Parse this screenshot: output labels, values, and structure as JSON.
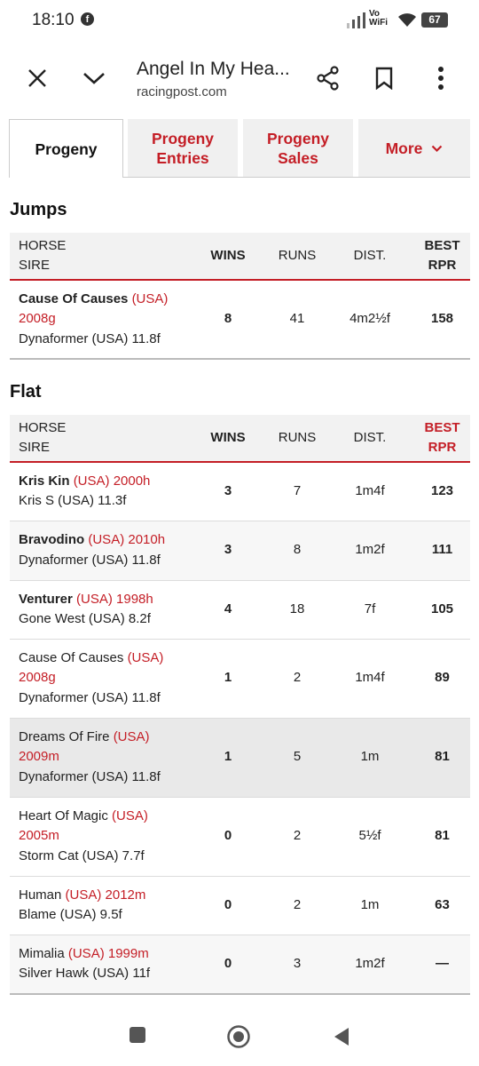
{
  "status": {
    "time": "18:10",
    "vowifi_top": "Vo",
    "vowifi_bottom": "WiFi",
    "battery": "67"
  },
  "appbar": {
    "title": "Angel In My Hea...",
    "url": "racingpost.com"
  },
  "tabs": [
    {
      "label_1": "Progeny",
      "label_2": ""
    },
    {
      "label_1": "Progeny",
      "label_2": "Entries"
    },
    {
      "label_1": "Progeny",
      "label_2": "Sales"
    },
    {
      "label_1": "More",
      "label_2": ""
    }
  ],
  "columns": {
    "horse": "HORSE",
    "sire": "SIRE",
    "wins": "WINS",
    "runs": "RUNS",
    "dist": "DIST.",
    "best": "BEST",
    "rpr": "RPR"
  },
  "jumps": {
    "title": "Jumps",
    "rows": [
      {
        "name": "Cause Of Causes",
        "origin_a": "(USA)",
        "origin_b": "2008g",
        "sire": "Dynaformer (USA) 11.8f",
        "wins": "8",
        "runs": "41",
        "dist": "4m2½f",
        "rpr": "158"
      }
    ]
  },
  "flat": {
    "title": "Flat",
    "rows": [
      {
        "name": "Kris Kin",
        "origin": "(USA) 2000h",
        "sire": "Kris S (USA) 11.3f",
        "wins": "3",
        "runs": "7",
        "dist": "1m4f",
        "rpr": "123"
      },
      {
        "name": "Bravodino",
        "origin": "(USA) 2010h",
        "sire": "Dynaformer (USA) 11.8f",
        "wins": "3",
        "runs": "8",
        "dist": "1m2f",
        "rpr": "111"
      },
      {
        "name": "Venturer",
        "origin": "(USA) 1998h",
        "sire": "Gone West (USA) 8.2f",
        "wins": "4",
        "runs": "18",
        "dist": "7f",
        "rpr": "105"
      },
      {
        "name": "Cause Of Causes",
        "origin_a": "(USA)",
        "origin_b": "2008g",
        "sire": "Dynaformer (USA) 11.8f",
        "wins": "1",
        "runs": "2",
        "dist": "1m4f",
        "rpr": "89"
      },
      {
        "name": "Dreams Of Fire",
        "origin_a": "(USA)",
        "origin_b": "2009m",
        "sire": "Dynaformer (USA) 11.8f",
        "wins": "1",
        "runs": "5",
        "dist": "1m",
        "rpr": "81"
      },
      {
        "name": "Heart Of Magic",
        "origin_a": "(USA)",
        "origin_b": "2005m",
        "sire": "Storm Cat (USA) 7.7f",
        "wins": "0",
        "runs": "2",
        "dist": "5½f",
        "rpr": "81"
      },
      {
        "name": "Human",
        "origin": "(USA) 2012m",
        "sire": "Blame (USA) 9.5f",
        "wins": "0",
        "runs": "2",
        "dist": "1m",
        "rpr": "63"
      },
      {
        "name": "Mimalia",
        "origin": "(USA) 1999m",
        "sire": "Silver Hawk (USA) 11f",
        "wins": "0",
        "runs": "3",
        "dist": "1m2f",
        "rpr": "—"
      }
    ]
  },
  "colors": {
    "accent": "#c41e26",
    "header_bg": "#f2f2f2",
    "tab_bg": "#f0f0f0",
    "highlight_row": "#e9e9e9"
  },
  "icons": [
    "facebook-icon",
    "signal-icon",
    "wifi-icon",
    "battery-icon",
    "close-icon",
    "chevron-down-icon",
    "share-icon",
    "bookmark-icon",
    "more-vert-icon",
    "nav-recents-icon",
    "nav-home-icon",
    "nav-back-icon"
  ]
}
